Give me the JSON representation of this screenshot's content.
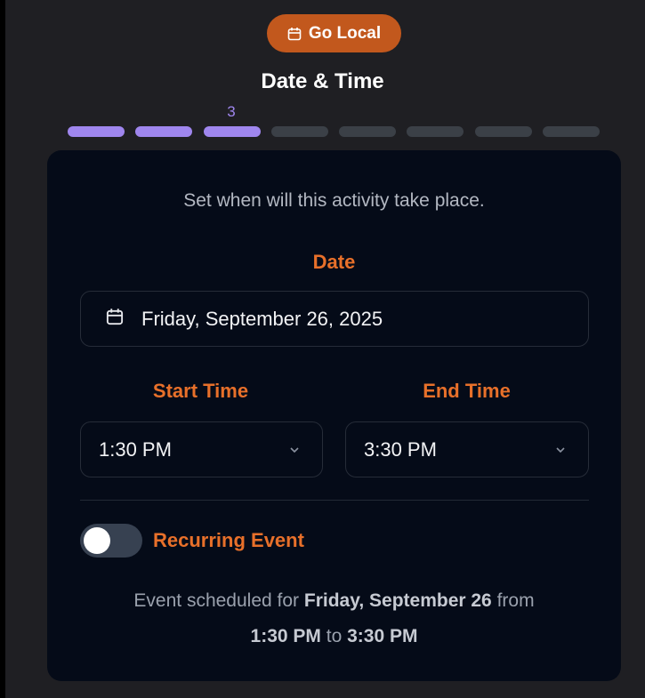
{
  "badge": {
    "label": "Go Local",
    "icon": "calendar-icon"
  },
  "header": {
    "title": "Date & Time",
    "current_step": "3"
  },
  "progress": {
    "total_steps": 8,
    "completed_steps": 3
  },
  "card": {
    "subtitle": "Set when will this activity take place.",
    "date": {
      "label": "Date",
      "value": "Friday, September 26, 2025",
      "icon": "calendar-icon"
    },
    "start_time": {
      "label": "Start Time",
      "value": "1:30 PM",
      "icon": "chevron-down-icon"
    },
    "end_time": {
      "label": "End Time",
      "value": "3:30 PM",
      "icon": "chevron-down-icon"
    },
    "recurring": {
      "label": "Recurring Event",
      "enabled": false
    },
    "summary": {
      "prefix": "Event scheduled for",
      "date": "Friday, September 26",
      "from_word": "from",
      "start": "1:30 PM",
      "to_word": "to",
      "end": "3:30 PM"
    }
  },
  "colors": {
    "accent_orange": "#e8702a",
    "badge_orange": "#c2581d",
    "progress_done": "#9f86ee",
    "progress_todo": "#3b4047",
    "card_bg": "#050b18",
    "page_bg": "#1f1f23"
  }
}
